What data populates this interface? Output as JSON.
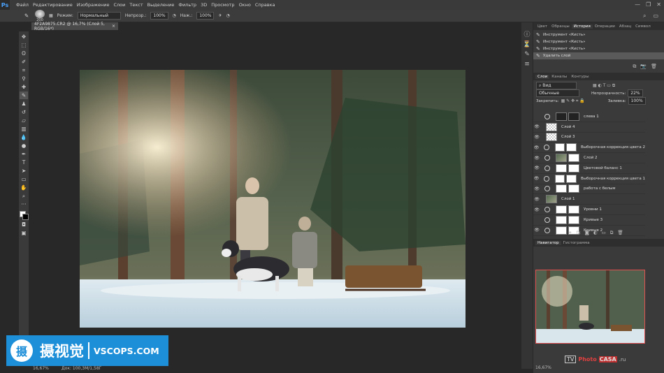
{
  "app": {
    "logo": "Ps",
    "window_controls": [
      "—",
      "❐",
      "✕"
    ]
  },
  "menu": [
    "Файл",
    "Редактирование",
    "Изображение",
    "Слои",
    "Текст",
    "Выделение",
    "Фильтр",
    "3D",
    "Просмотр",
    "Окно",
    "Справка"
  ],
  "options": {
    "brush_size": "200",
    "mode_label": "Режим:",
    "mode_value": "Нормальный",
    "opacity_label": "Непрозр.:",
    "opacity_value": "100%",
    "pressure_label": "Наж.:",
    "pressure_value": "100%"
  },
  "document": {
    "tab_title": "4F2A9875.CR2 @ 16,7% (Слой 5, RGB/16*)",
    "tab_close": "×",
    "zoom": "16,67%",
    "doc_info": "Док: 100,3M/1,58Г"
  },
  "panels": {
    "top_tabs": [
      "Цвет",
      "Образцы",
      "История",
      "Операции",
      "Абзац",
      "Символ"
    ],
    "active_top_tab": "История",
    "history": [
      {
        "label": "Инструмент «Кисть»"
      },
      {
        "label": "Инструмент «Кисть»"
      },
      {
        "label": "Инструмент «Кисть»"
      },
      {
        "label": "Удалить слой"
      }
    ],
    "layer_tabs": [
      "Слои",
      "Каналы",
      "Контуры"
    ],
    "active_layer_tab": "Слои",
    "kind_label": "Вид",
    "blend_mode": "Обычные",
    "opacity_label": "Непрозрачность:",
    "opacity_value": "22%",
    "lock_label": "Закрепить:",
    "fill_label": "Заливка:",
    "fill_value": "100%",
    "layers": [
      {
        "name": "слева 1",
        "thumb": "dark",
        "mask": true,
        "visible": false
      },
      {
        "name": "Слой 4",
        "thumb": "check",
        "mask": false,
        "visible": true
      },
      {
        "name": "Слой 3",
        "thumb": "check",
        "mask": false,
        "visible": true
      },
      {
        "name": "Выборочная коррекция цвета 2",
        "thumb": "white",
        "mask": true,
        "visible": true
      },
      {
        "name": "Слой 2",
        "thumb": "img",
        "mask": true,
        "visible": true
      },
      {
        "name": "Цветовой баланс 1",
        "thumb": "white",
        "mask": true,
        "visible": true
      },
      {
        "name": "Выборочная коррекция цвета 1",
        "thumb": "white",
        "mask": true,
        "visible": true
      },
      {
        "name": "работа с белым",
        "thumb": "white",
        "mask": true,
        "visible": true
      },
      {
        "name": "Слой 1",
        "thumb": "img",
        "mask": false,
        "visible": true
      },
      {
        "name": "Уровни 1",
        "thumb": "white",
        "mask": true,
        "visible": true
      },
      {
        "name": "Кривые 3",
        "thumb": "white",
        "mask": true,
        "visible": false
      },
      {
        "name": "Кривые 2",
        "thumb": "white",
        "mask": true,
        "visible": true
      }
    ],
    "nav_tabs": [
      "Навигатор",
      "Гистограмма"
    ],
    "active_nav_tab": "Навигатор",
    "nav_zoom": "16,67%"
  },
  "watermarks": {
    "left_logo": "摄",
    "left_cn": "摄视觉",
    "left_site": "VSCOPS.COM",
    "right_tv": "TV",
    "right_photo": "Photo",
    "right_casa": "CASA",
    "right_ru": ".ru"
  }
}
